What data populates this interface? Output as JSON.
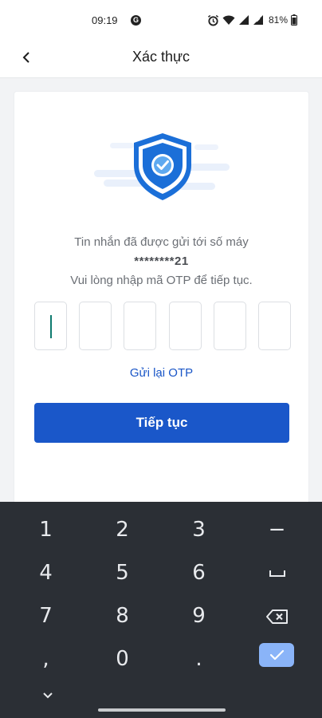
{
  "status_bar": {
    "time": "09:19",
    "g_icon": "G",
    "battery": "81%",
    "icons": [
      "alarm-icon",
      "wifi-icon",
      "signal-icon",
      "signal-icon",
      "battery-icon"
    ]
  },
  "header": {
    "title": "Xác thực",
    "back_icon": "chevron-left-icon"
  },
  "verification": {
    "illustration_icon": "shield-check-icon",
    "message_line1": "Tin nhắn đã được gửi tới số máy",
    "masked_phone": "********21",
    "message_line2": "Vui lòng nhập mã OTP để tiếp tục.",
    "otp_digits": [
      "",
      "",
      "",
      "",
      "",
      ""
    ],
    "resend_label": "Gửi lại OTP",
    "continue_label": "Tiếp tục"
  },
  "keyboard": {
    "keys": [
      [
        "1",
        "2",
        "3",
        "−"
      ],
      [
        "4",
        "5",
        "6",
        "␣"
      ],
      [
        "7",
        "8",
        "9",
        "⌫"
      ],
      [
        ",",
        "0",
        ".",
        "✓"
      ]
    ],
    "enter_color": "#8ab4f8"
  },
  "colors": {
    "primary": "#1a57c9",
    "link": "#1a56c7",
    "keyboard_bg": "#2b2f35"
  }
}
